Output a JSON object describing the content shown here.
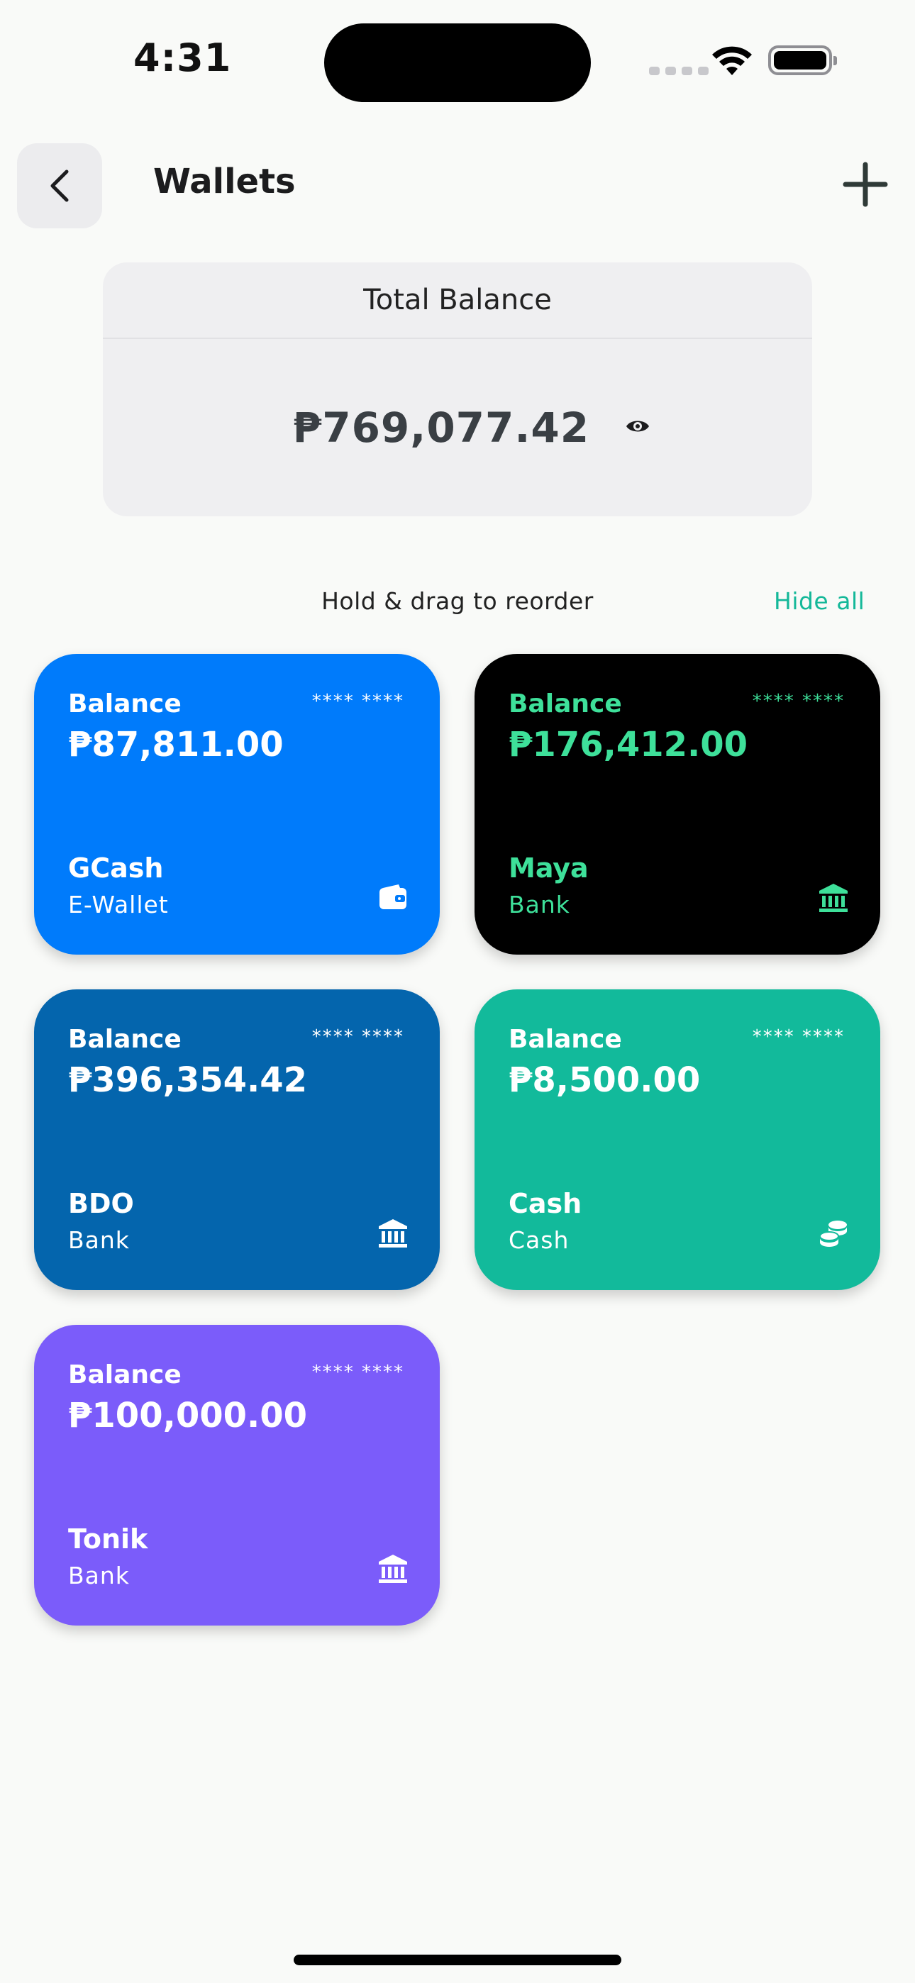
{
  "status_bar": {
    "time": "4:31"
  },
  "header": {
    "title": "Wallets",
    "back_icon": "chevron-left-icon",
    "add_icon": "plus-icon"
  },
  "total": {
    "label": "Total Balance",
    "value": "₱769,077.42",
    "visibility_icon": "eye-icon"
  },
  "reorder": {
    "hint": "Hold & drag to reorder",
    "hide_all_label": "Hide all",
    "accent_color": "#14b899"
  },
  "wallets": [
    {
      "balance_label": "Balance",
      "mask": "**** ****",
      "amount": "₱87,811.00",
      "name": "GCash",
      "type": "E-Wallet",
      "icon": "wallet-icon",
      "background": "#007bfb",
      "text_color": "#ffffff"
    },
    {
      "balance_label": "Balance",
      "mask": "**** ****",
      "amount": "₱176,412.00",
      "name": "Maya",
      "type": "Bank",
      "icon": "bank-icon",
      "background": "#000000",
      "text_color": "#3ee09a"
    },
    {
      "balance_label": "Balance",
      "mask": "**** ****",
      "amount": "₱396,354.42",
      "name": "BDO",
      "type": "Bank",
      "icon": "bank-icon",
      "background": "#0465ad",
      "text_color": "#ffffff"
    },
    {
      "balance_label": "Balance",
      "mask": "**** ****",
      "amount": "₱8,500.00",
      "name": "Cash",
      "type": "Cash",
      "icon": "coins-icon",
      "background": "#12ba9b",
      "text_color": "#ffffff"
    },
    {
      "balance_label": "Balance",
      "mask": "**** ****",
      "amount": "₱100,000.00",
      "name": "Tonik",
      "type": "Bank",
      "icon": "bank-icon",
      "background": "#7b5cfa",
      "text_color": "#ffffff"
    }
  ]
}
